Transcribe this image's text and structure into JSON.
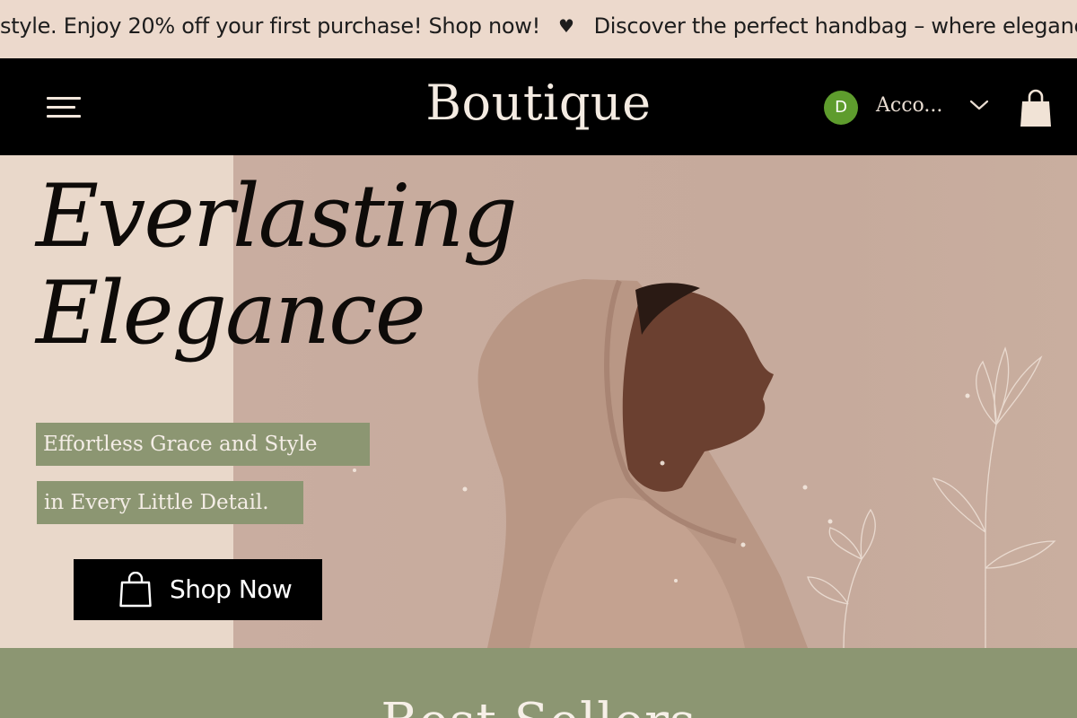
{
  "announcement": {
    "message_start": "style. Enjoy 20% off your first purchase! Shop now!",
    "separator": "♥",
    "message_next": "Discover the perfect handbag – where elegance m"
  },
  "header": {
    "brand": "Boutique",
    "menu_icon": "hamburger-icon",
    "account": {
      "avatar_initial": "D",
      "label": "Acco...",
      "avatar_color": "#5e9c2d"
    },
    "cart_icon": "shopping-bag-icon"
  },
  "hero": {
    "title_line1": "Everlasting",
    "title_line2": "Elegance",
    "tagline_1": "Effortless Grace and Style",
    "tagline_2": "in Every Little Detail.",
    "cta_label": "Shop Now",
    "cta_icon": "shopping-bag-icon",
    "accent_color": "#8c9672",
    "background_color": "#e9d8ca"
  },
  "best_sellers": {
    "title": "Best Sellers"
  }
}
